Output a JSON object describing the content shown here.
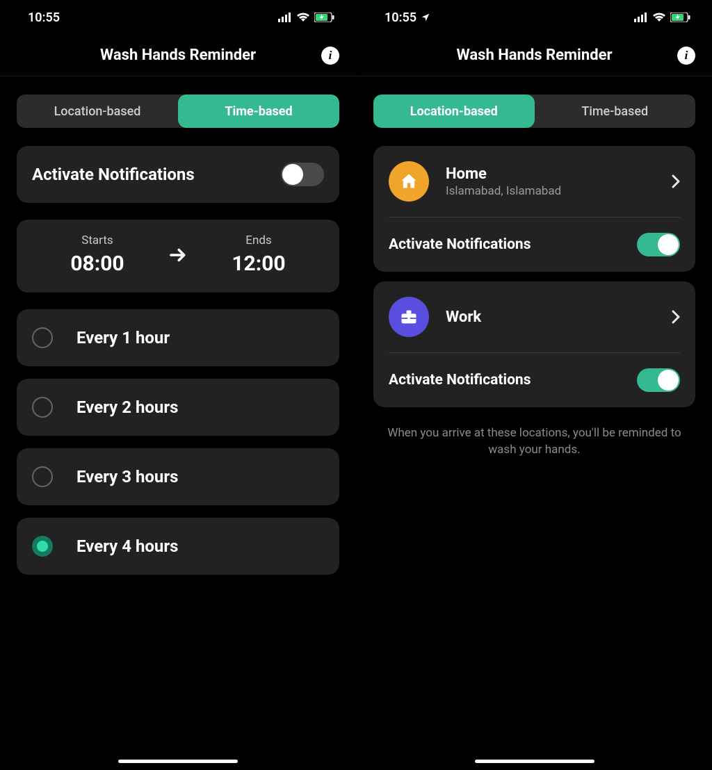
{
  "statusBar": {
    "time": "10:55"
  },
  "header": {
    "title": "Wash Hands Reminder"
  },
  "segments": {
    "location": "Location-based",
    "time": "Time-based"
  },
  "left": {
    "activateLabel": "Activate Notifications",
    "startsLabel": "Starts",
    "startsValue": "08:00",
    "endsLabel": "Ends",
    "endsValue": "12:00",
    "options": [
      "Every 1 hour",
      "Every 2 hours",
      "Every 3 hours",
      "Every 4 hours"
    ],
    "selectedIndex": 3
  },
  "right": {
    "locations": [
      {
        "name": "Home",
        "sub": "Islamabad, Islamabad"
      },
      {
        "name": "Work",
        "sub": ""
      }
    ],
    "activateLabel": "Activate Notifications",
    "footnote": "When you arrive at these locations, you'll be reminded to wash your hands."
  }
}
